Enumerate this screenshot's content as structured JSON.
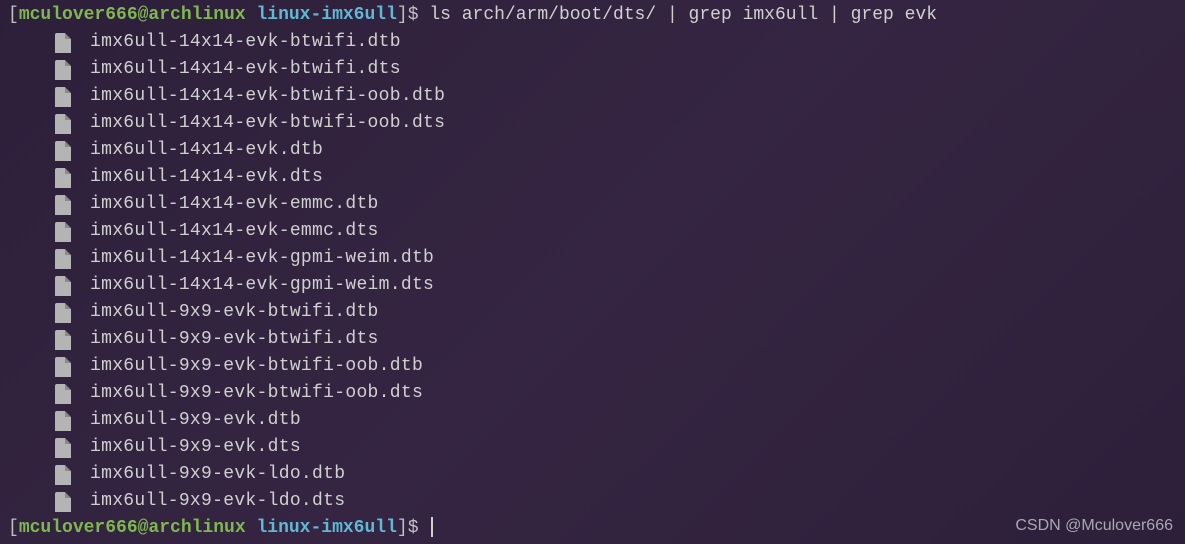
{
  "prompt1": {
    "open_bracket": "[",
    "user_host": "mculover666@archlinux",
    "separator": " ",
    "directory": "linux-imx6ull",
    "close_bracket": "]$",
    "command": " ls arch/arm/boot/dts/ | grep imx6ull | grep evk"
  },
  "files": [
    "imx6ull-14x14-evk-btwifi.dtb",
    "imx6ull-14x14-evk-btwifi.dts",
    "imx6ull-14x14-evk-btwifi-oob.dtb",
    "imx6ull-14x14-evk-btwifi-oob.dts",
    "imx6ull-14x14-evk.dtb",
    "imx6ull-14x14-evk.dts",
    "imx6ull-14x14-evk-emmc.dtb",
    "imx6ull-14x14-evk-emmc.dts",
    "imx6ull-14x14-evk-gpmi-weim.dtb",
    "imx6ull-14x14-evk-gpmi-weim.dts",
    "imx6ull-9x9-evk-btwifi.dtb",
    "imx6ull-9x9-evk-btwifi.dts",
    "imx6ull-9x9-evk-btwifi-oob.dtb",
    "imx6ull-9x9-evk-btwifi-oob.dts",
    "imx6ull-9x9-evk.dtb",
    "imx6ull-9x9-evk.dts",
    "imx6ull-9x9-evk-ldo.dtb",
    "imx6ull-9x9-evk-ldo.dts"
  ],
  "prompt2": {
    "open_bracket": "[",
    "user_host": "mculover666@archlinux",
    "separator": " ",
    "directory": "linux-imx6ull",
    "close_bracket": "]$",
    "command": " "
  },
  "watermark": "CSDN @Mculover666"
}
